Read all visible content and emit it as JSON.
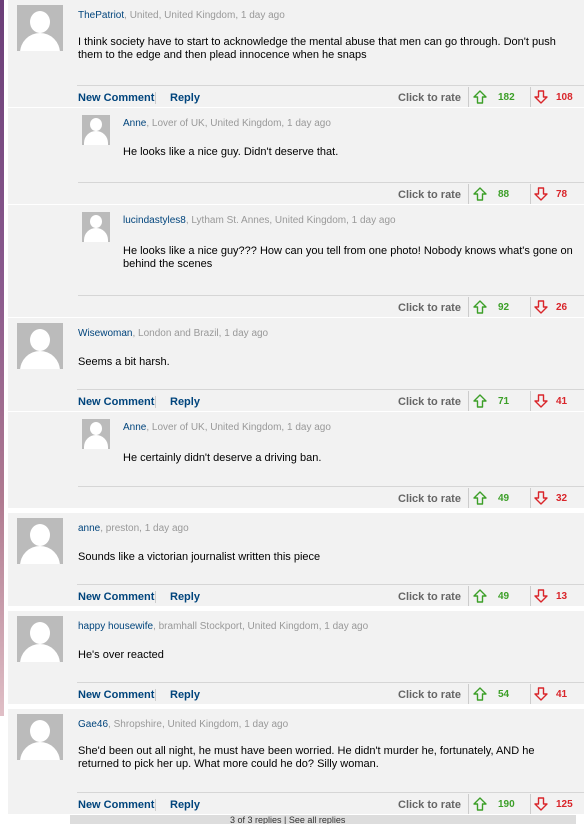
{
  "labels": {
    "new_comment": "New Comment",
    "reply": "Reply",
    "click_to_rate": "Click to rate"
  },
  "comments": [
    {
      "user": "ThePatriot",
      "loc": ", United, United Kingdom, 1 day ago",
      "text": "I think society have to start to acknowledge the mental abuse that men can go through. Don't push them to the edge and then plead innocence when he snaps",
      "up": "182",
      "down": "108"
    },
    {
      "user": "Anne",
      "loc": ", Lover of UK, United Kingdom, 1 day ago",
      "text": "He looks like a nice guy. Didn't deserve that.",
      "up": "88",
      "down": "78"
    },
    {
      "user": "lucindastyles8",
      "loc": ", Lytham St. Annes, United Kingdom, 1 day ago",
      "text": "He looks like a nice guy??? How can you tell from one photo! Nobody knows what's gone on behind the scenes",
      "up": "92",
      "down": "26"
    },
    {
      "user": "Wisewoman",
      "loc": ", London and Brazil, 1 day ago",
      "text": "Seems a bit harsh.",
      "up": "71",
      "down": "41"
    },
    {
      "user": "Anne",
      "loc": ", Lover of UK, United Kingdom, 1 day ago",
      "text": "He certainly didn't deserve a driving ban.",
      "up": "49",
      "down": "32"
    },
    {
      "user": "anne",
      "loc": ", preston, 1 day ago",
      "text": "Sounds like a victorian journalist written this piece",
      "up": "49",
      "down": "13"
    },
    {
      "user": "happy housewife",
      "loc": ", bramhall Stockport, United Kingdom, 1 day ago",
      "text": "He's over reacted",
      "up": "54",
      "down": "41"
    },
    {
      "user": "Gae46",
      "loc": ", Shropshire, United Kingdom, 1 day ago",
      "text": "She'd been out all night, he must have been worried. He didn't murder he, fortunately, AND he returned to pick her up. What more could he do? Silly woman.",
      "up": "190",
      "down": "125"
    }
  ],
  "footer_partial": "3 of 3 replies | See all replies"
}
